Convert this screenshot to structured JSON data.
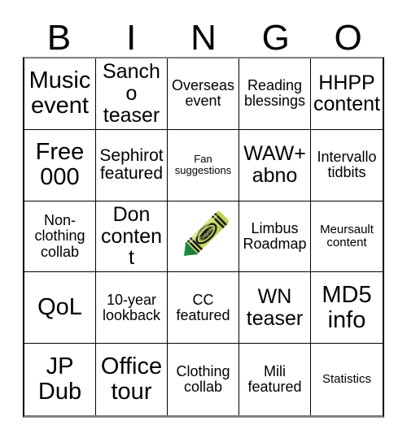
{
  "card": {
    "header_letters": [
      "B",
      "I",
      "N",
      "G",
      "O"
    ],
    "rows": [
      [
        {
          "text": "Music\nevent",
          "size": "xl"
        },
        {
          "text": "Sancho\nteaser",
          "size": "lg"
        },
        {
          "text": "Overseas\nevent",
          "size": "sm"
        },
        {
          "text": "Reading\nblessings",
          "size": "sm"
        },
        {
          "text": "HHPP\ncontent",
          "size": "lg"
        }
      ],
      [
        {
          "text": "Free\n000",
          "size": "xl"
        },
        {
          "text": "Sephirot\nfeatured",
          "size": "md"
        },
        {
          "text": "Fan\nsuggestions",
          "size": "xxs"
        },
        {
          "text": "WAW+\nabno",
          "size": "lg"
        },
        {
          "text": "Intervallo\ntidbits",
          "size": "sm"
        }
      ],
      [
        {
          "text": "Non-\nclothing\ncollab",
          "size": "sm"
        },
        {
          "text": "Don\ncontent",
          "size": "lg"
        },
        {
          "text": "",
          "size": "md",
          "free_space": true,
          "icon": "crayola-crayon-green"
        },
        {
          "text": "Limbus\nRoadmap",
          "size": "sm"
        },
        {
          "text": "Meursault\ncontent",
          "size": "xs"
        }
      ],
      [
        {
          "text": "QoL",
          "size": "xl"
        },
        {
          "text": "10-year\nlookback",
          "size": "sm"
        },
        {
          "text": "CC\nfeatured",
          "size": "sm"
        },
        {
          "text": "WN\nteaser",
          "size": "lg"
        },
        {
          "text": "MD5\ninfo",
          "size": "xl"
        }
      ],
      [
        {
          "text": "JP\nDub",
          "size": "xl"
        },
        {
          "text": "Office\ntour",
          "size": "xl"
        },
        {
          "text": "Clothing\ncollab",
          "size": "sm"
        },
        {
          "text": "Mili\nfeatured",
          "size": "sm"
        },
        {
          "text": "Statistics",
          "size": "xs"
        }
      ]
    ],
    "free_space": {
      "icon_name": "crayola-crayon-green",
      "brand_text": "Crayola",
      "colors": {
        "body": "#c8dc5f",
        "body_light": "#dce98e",
        "body_shadow": "#aec24a",
        "tip": "#1f8a3b",
        "tip_dark": "#11682a",
        "bands": "#1a1a1a",
        "label": "#1f1f1f"
      }
    },
    "colors": {
      "background": "#ffffff",
      "text": "#000000",
      "grid_line": "#000000",
      "grid_edge": "#808080"
    }
  }
}
